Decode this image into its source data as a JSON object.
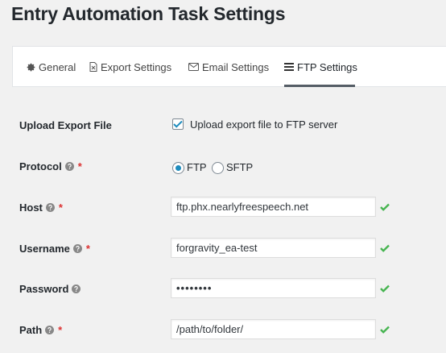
{
  "page": {
    "title": "Entry Automation Task Settings"
  },
  "tabs": [
    {
      "label": "General",
      "icon": "gear-icon",
      "active": false
    },
    {
      "label": "Export Settings",
      "icon": "document-icon",
      "active": false
    },
    {
      "label": "Email Settings",
      "icon": "envelope-icon",
      "active": false
    },
    {
      "label": "FTP Settings",
      "icon": "server-icon",
      "active": true
    }
  ],
  "form": {
    "upload": {
      "label": "Upload Export File",
      "checkbox_label": "Upload export file to FTP server",
      "checked": true
    },
    "protocol": {
      "label": "Protocol",
      "required": "*",
      "options": [
        {
          "label": "FTP",
          "selected": true
        },
        {
          "label": "SFTP",
          "selected": false
        }
      ]
    },
    "host": {
      "label": "Host",
      "required": "*",
      "value": "ftp.phx.nearlyfreespeech.net",
      "valid": true
    },
    "username": {
      "label": "Username",
      "required": "*",
      "value": "forgravity_ea-test",
      "valid": true
    },
    "password": {
      "label": "Password",
      "value": "••••••••",
      "valid": true
    },
    "path": {
      "label": "Path",
      "required": "*",
      "value": "/path/to/folder/",
      "valid": true
    }
  },
  "colors": {
    "accent": "#1e8cbe",
    "success": "#46b450",
    "required": "#dc3232",
    "help_icon": "#888888"
  }
}
